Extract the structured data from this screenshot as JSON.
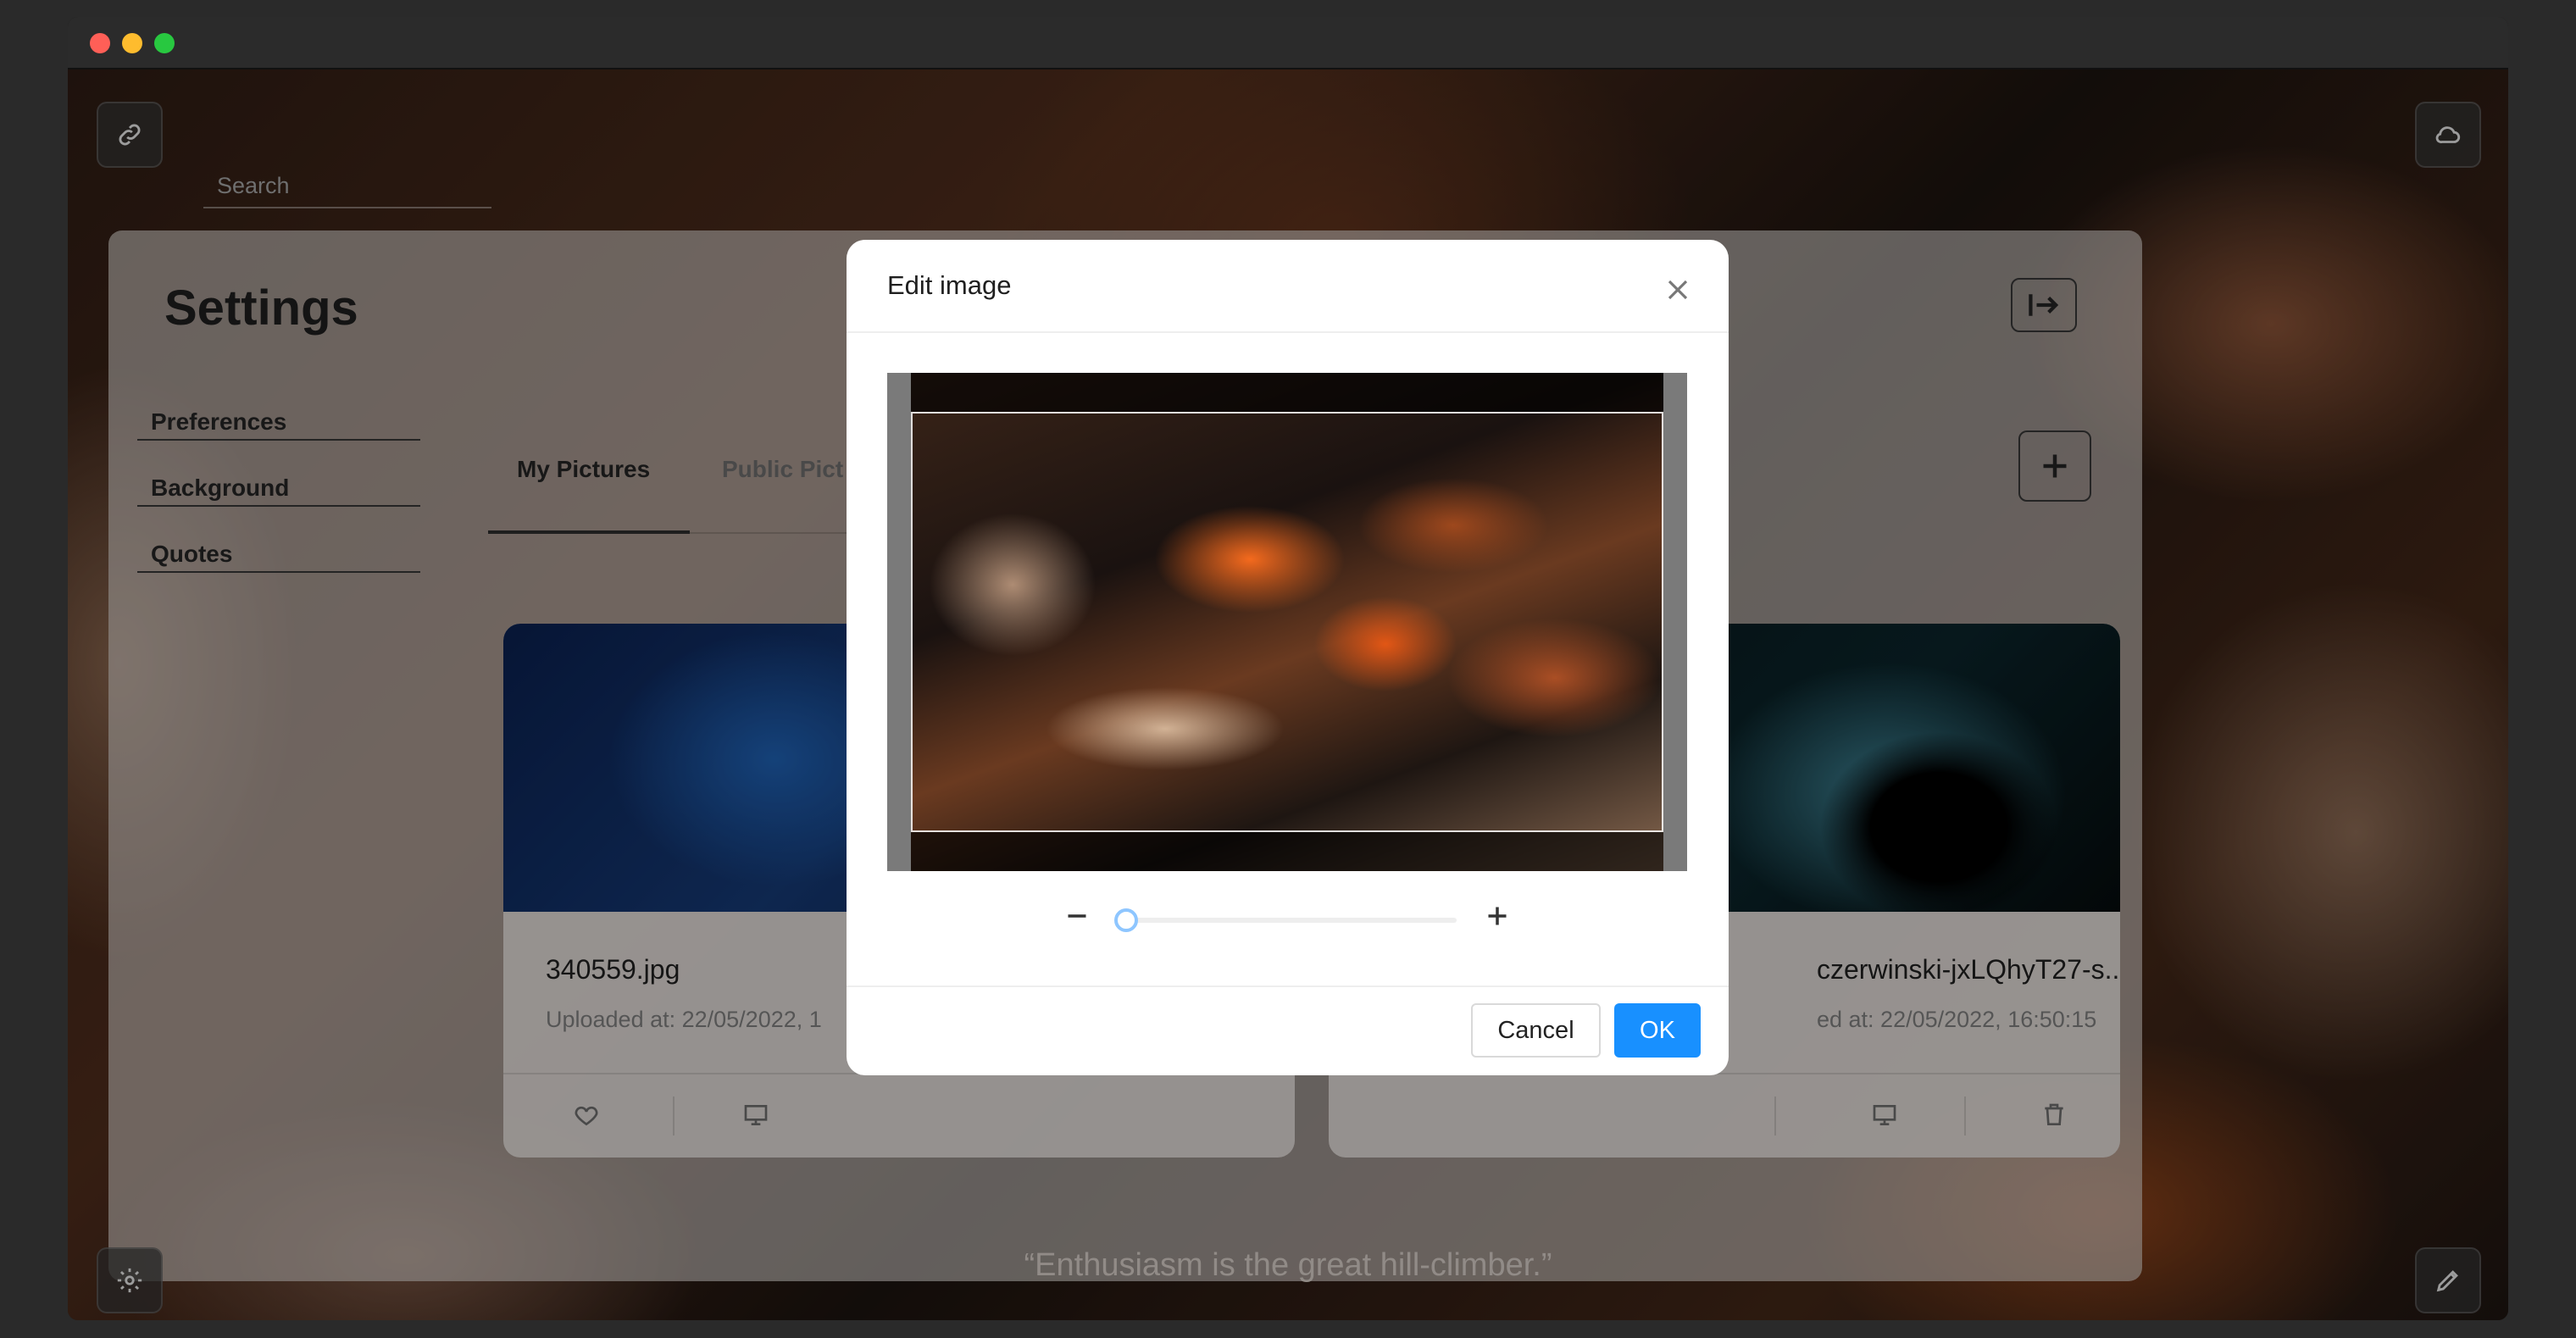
{
  "search": {
    "placeholder": "Search"
  },
  "settings": {
    "title": "Settings",
    "sidebar": [
      "Preferences",
      "Background",
      "Quotes"
    ],
    "tabs": [
      {
        "label": "My Pictures",
        "active": true
      },
      {
        "label": "Public Pict",
        "active": false
      }
    ]
  },
  "cards": [
    {
      "name": "340559.jpg",
      "uploaded": "Uploaded at: 22/05/2022, 1"
    },
    {
      "name": "czerwinski-jxLQhyT27-s...",
      "uploaded": "ed at: 22/05/2022, 16:50:15"
    }
  ],
  "quote": "“Enthusiasm is the great hill-climber.”",
  "modal": {
    "title": "Edit image",
    "zoom_level": 0.0,
    "cancel_label": "Cancel",
    "ok_label": "OK"
  },
  "colors": {
    "primary": "#1890ff",
    "slider_handle": "#8ec6ff"
  },
  "icons": [
    "link-icon",
    "cloud-icon",
    "exit-icon",
    "plus-icon",
    "heart-icon",
    "monitor-icon",
    "trash-icon",
    "gear-icon",
    "pencil-icon",
    "close-icon",
    "minus-icon"
  ]
}
